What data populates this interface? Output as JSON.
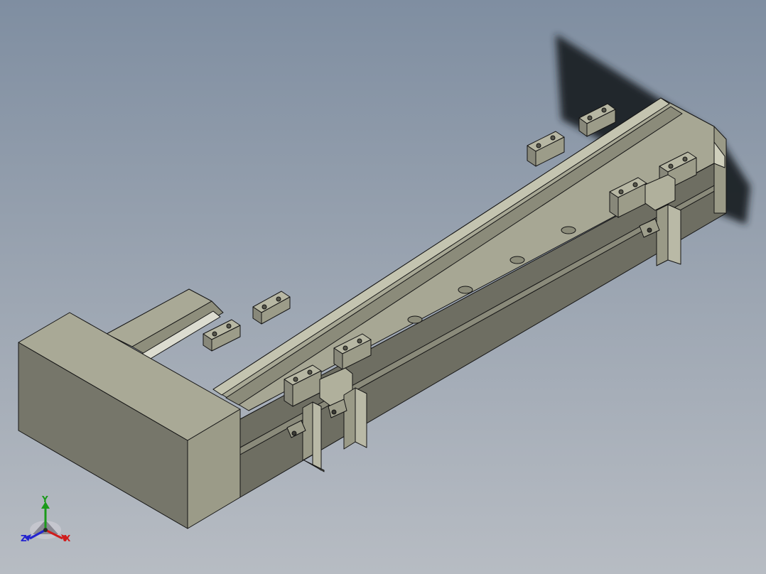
{
  "viewport": {
    "background_top": "#7f8ea1",
    "background_bottom": "#b7bcc3"
  },
  "model": {
    "colors": {
      "face_light": "#b4b4a0",
      "face_mid": "#9b9b88",
      "face_dark": "#6f6f62",
      "edge": "#141414",
      "shadow": "#1f2225"
    }
  },
  "view_triad": {
    "icon": "view-orientation-triad-icon",
    "axes": {
      "y": {
        "label": "Y",
        "color": "#1a9a1a"
      },
      "z": {
        "label": "Z",
        "color": "#2424d0"
      },
      "x": {
        "label": "X",
        "color": "#d01c1c"
      }
    }
  }
}
